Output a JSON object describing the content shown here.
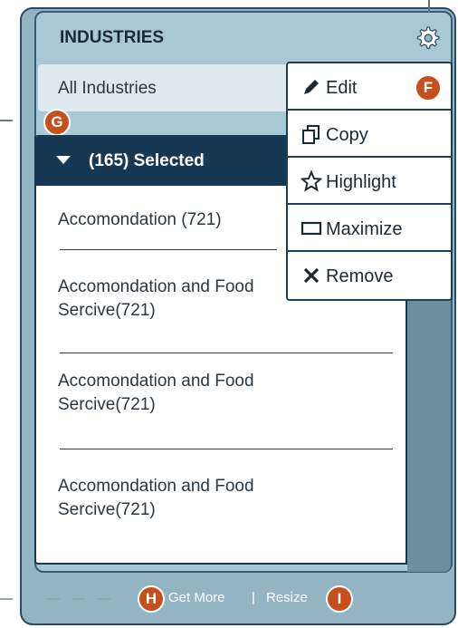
{
  "widget": {
    "title": "INDUSTRIES",
    "filter_value": "All Industries",
    "selected_header": "(165) Selected"
  },
  "items": [
    {
      "line1": "Accomondation (721)",
      "line2": ""
    },
    {
      "line1": "Accomondation and Food",
      "line2": "Sercive(721)"
    },
    {
      "line1": "Accomondation and Food",
      "line2": "Sercive(721)"
    },
    {
      "line1": "Accomondation and Food",
      "line2": "Sercive(721)"
    }
  ],
  "menu": {
    "edit": "Edit",
    "copy": "Copy",
    "highlight": "Highlight",
    "maximize": "Maximize",
    "remove": "Remove"
  },
  "footer": {
    "get_more": "Get More",
    "divider": "|",
    "resize": "Resize"
  },
  "callouts": {
    "f": "F",
    "g": "G",
    "h": "H",
    "i": "I"
  },
  "colors": {
    "accent": "#c5501e",
    "header_navy": "#173852",
    "frame_blue": "#92b4c3"
  }
}
